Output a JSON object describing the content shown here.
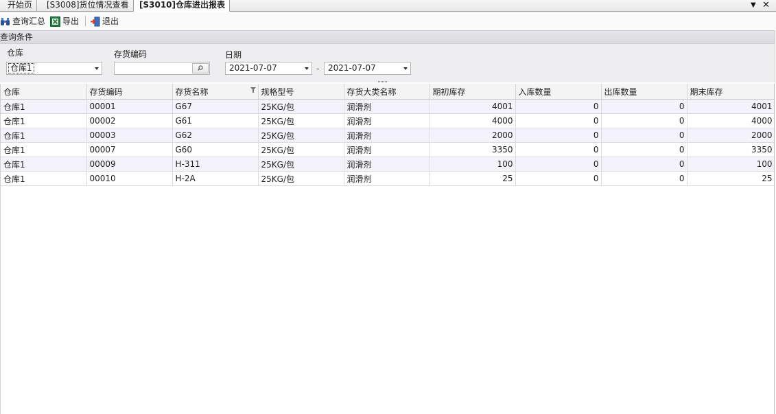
{
  "tabs": [
    {
      "label": "开始页",
      "active": false
    },
    {
      "label": "[S3008]货位情况查看",
      "active": false
    },
    {
      "label": "[S3010]仓库进出报表",
      "active": true
    }
  ],
  "tab_controls": {
    "dropdown_icon": "chevron-down-icon",
    "close_icon": "close-icon"
  },
  "toolbar": {
    "query_label": "查询汇总",
    "export_label": "导出",
    "exit_label": "退出"
  },
  "query_panel": {
    "header": "查询条件",
    "warehouse_label": "仓库",
    "warehouse_value": "仓库1",
    "item_code_label": "存货编码",
    "item_code_value": "",
    "date_label": "日期",
    "date_from": "2021-07-07",
    "date_sep": "-",
    "date_to": "2021-07-07"
  },
  "grid": {
    "columns": [
      "仓库",
      "存货编码",
      "存货名称",
      "规格型号",
      "存货大类名称",
      "期初库存",
      "入库数量",
      "出库数量",
      "期末库存"
    ],
    "rows": [
      [
        "仓库1",
        "00001",
        "G67",
        "25KG/包",
        "润滑剂",
        "4001",
        "0",
        "0",
        "4001"
      ],
      [
        "仓库1",
        "00002",
        "G61",
        "25KG/包",
        "润滑剂",
        "4000",
        "0",
        "0",
        "4000"
      ],
      [
        "仓库1",
        "00003",
        "G62",
        "25KG/包",
        "润滑剂",
        "2000",
        "0",
        "0",
        "2000"
      ],
      [
        "仓库1",
        "00007",
        "G60",
        "25KG/包",
        "润滑剂",
        "3350",
        "0",
        "0",
        "3350"
      ],
      [
        "仓库1",
        "00009",
        "H-311",
        "25KG/包",
        "润滑剂",
        "100",
        "0",
        "0",
        "100"
      ],
      [
        "仓库1",
        "00010",
        "H-2A",
        "25KG/包",
        "润滑剂",
        "25",
        "0",
        "0",
        "25"
      ]
    ]
  },
  "colors": {
    "alt_row": "#f4f2fb",
    "panel_bg": "#eeeef0",
    "export_icon": "#1f7a3a",
    "exit_icon": "#d83a2a"
  }
}
